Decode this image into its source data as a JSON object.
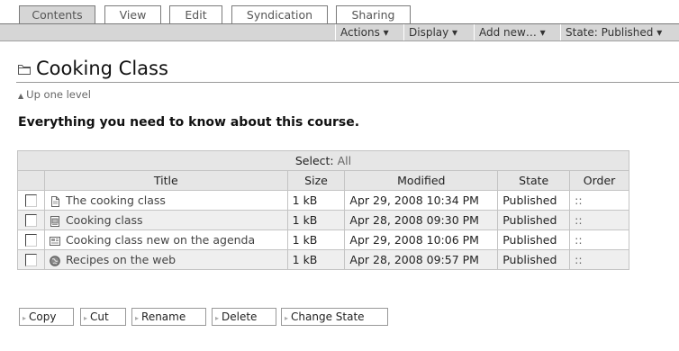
{
  "tabs": [
    {
      "label": "Contents",
      "active": true
    },
    {
      "label": "View",
      "active": false
    },
    {
      "label": "Edit",
      "active": false
    },
    {
      "label": "Syndication",
      "active": false
    },
    {
      "label": "Sharing",
      "active": false
    }
  ],
  "actions_bar": {
    "actions": "Actions ▾",
    "display": "Display ▾",
    "add_new": "Add new… ▾",
    "state": "State: Published ▾"
  },
  "page": {
    "title": "Cooking Class",
    "up_level": "Up one level",
    "description": "Everything you need to know about this course."
  },
  "table": {
    "select_label": "Select:",
    "select_all": "All",
    "headers": {
      "title": "Title",
      "size": "Size",
      "modified": "Modified",
      "state": "State",
      "order": "Order"
    },
    "rows": [
      {
        "icon": "document-icon",
        "title": "The cooking class",
        "size": "1 kB",
        "modified": "Apr 29, 2008 10:34 PM",
        "state": "Published",
        "order": "::"
      },
      {
        "icon": "image-icon",
        "title": "Cooking class",
        "size": "1 kB",
        "modified": "Apr 28, 2008 09:30 PM",
        "state": "Published",
        "order": "::"
      },
      {
        "icon": "news-item-icon",
        "title": "Cooking class new on the agenda",
        "size": "1 kB",
        "modified": "Apr 29, 2008 10:06 PM",
        "state": "Published",
        "order": "::"
      },
      {
        "icon": "link-icon",
        "title": "Recipes on the web",
        "size": "1 kB",
        "modified": "Apr 28, 2008 09:57 PM",
        "state": "Published",
        "order": "::"
      }
    ]
  },
  "buttons": {
    "copy": "Copy",
    "cut": "Cut",
    "rename": "Rename",
    "delete": "Delete",
    "change_state": "Change State"
  },
  "colors": {
    "tab_active_bg": "#d6d6d6",
    "bar_bg": "#d6d6d6",
    "row_alt_bg": "#efefef",
    "border": "#c4c4c4"
  }
}
